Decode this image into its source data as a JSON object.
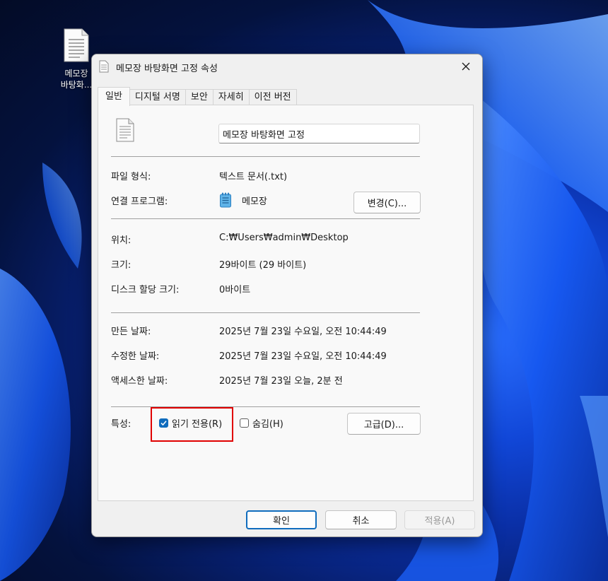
{
  "desktop": {
    "icon_label_line1": "메모장",
    "icon_label_line2": "바탕화..."
  },
  "window": {
    "title": "메모장 바탕화면 고정 속성"
  },
  "tabs": [
    {
      "label": "일반",
      "active": true
    },
    {
      "label": "디지털 서명"
    },
    {
      "label": "보안"
    },
    {
      "label": "자세히"
    },
    {
      "label": "이전 버전"
    }
  ],
  "general": {
    "file_name": "메모장 바탕화면 고정",
    "file_type_label": "파일 형식:",
    "file_type_value": "텍스트 문서(.txt)",
    "opens_with_label": "연결 프로그램:",
    "opens_with_value": "메모장",
    "change_button": "변경(C)...",
    "location_label": "위치:",
    "location_value": "C:₩Users₩admin₩Desktop",
    "size_label": "크기:",
    "size_value": "29바이트 (29 바이트)",
    "size_on_disk_label": "디스크 할당 크기:",
    "size_on_disk_value": "0바이트",
    "created_label": "만든 날짜:",
    "created_value": "2025년 7월 23일 수요일, 오전 10:44:49",
    "modified_label": "수정한 날짜:",
    "modified_value": "2025년 7월 23일 수요일, 오전 10:44:49",
    "accessed_label": "액세스한 날짜:",
    "accessed_value": "2025년 7월 23일 오늘, 2분 전",
    "attributes_label": "특성:",
    "readonly_label": "읽기 전용(R)",
    "readonly_checked": true,
    "hidden_label": "숨김(H)",
    "hidden_checked": false,
    "advanced_button": "고급(D)..."
  },
  "footer": {
    "ok": "확인",
    "cancel": "취소",
    "apply": "적용(A)"
  },
  "colors": {
    "accent": "#0f6cbd",
    "highlight": "#e00000"
  }
}
